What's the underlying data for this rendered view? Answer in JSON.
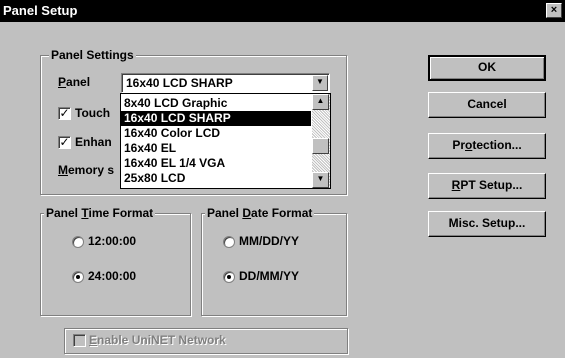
{
  "window": {
    "title": "Panel Setup",
    "close_glyph": "×"
  },
  "panel_settings": {
    "legend": "Panel Settings",
    "panel_label_mnemonic": "P",
    "panel_label_rest": "anel",
    "panel_value": "16x40 LCD SHARP",
    "touch_label": "Touch",
    "touch_checked": true,
    "enhanced_label": "Enhan",
    "enhanced_checked": true,
    "memory_label_mnemonic": "M",
    "memory_label_rest": "emory s"
  },
  "dropdown": {
    "options": [
      "8x40 LCD Graphic",
      "16x40 LCD SHARP",
      "16x40 Color LCD",
      "16x40 EL",
      "16x40 EL 1/4 VGA",
      "25x80 LCD"
    ],
    "selected_index": 1
  },
  "time_format": {
    "legend_pre": "Panel ",
    "legend_mnemonic": "T",
    "legend_post": "ime Format",
    "options": [
      "12:00:00",
      "24:00:00"
    ],
    "selected_index": 1
  },
  "date_format": {
    "legend_pre": "Panel ",
    "legend_mnemonic": "D",
    "legend_post": "ate Format",
    "options": [
      "MM/DD/YY",
      "DD/MM/YY"
    ],
    "selected_index": 1
  },
  "unet": {
    "label_mnemonic": "E",
    "label_rest": "nable UniNET Network",
    "enabled": false
  },
  "buttons": {
    "ok": "OK",
    "cancel": "Cancel",
    "protection_pre": "Pr",
    "protection_mnemonic": "o",
    "protection_post": "tection...",
    "rpt_mnemonic": "R",
    "rpt_rest": "PT Setup...",
    "misc": "Misc. Setup..."
  },
  "icons": {
    "checkmark": "✓",
    "dropdown_arrow": "▼",
    "scroll_up": "▲",
    "scroll_down": "▼"
  }
}
